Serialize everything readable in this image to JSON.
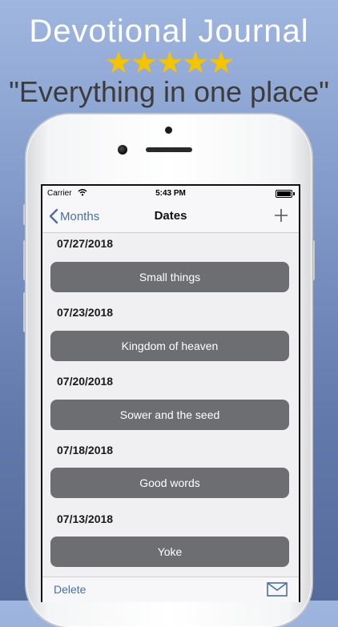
{
  "promo": {
    "title": "Devotional Journal",
    "stars": "★★★★★",
    "tagline": "\"Everything in one place\""
  },
  "status_bar": {
    "carrier": "Carrier",
    "time": "5:43 PM"
  },
  "nav": {
    "back_label": "Months",
    "title": "Dates"
  },
  "entries": [
    {
      "date": "07/27/2018",
      "title": "Small things"
    },
    {
      "date": "07/23/2018",
      "title": "Kingdom of heaven"
    },
    {
      "date": "07/20/2018",
      "title": "Sower and the seed"
    },
    {
      "date": "07/18/2018",
      "title": "Good words"
    },
    {
      "date": "07/13/2018",
      "title": "Yoke"
    }
  ],
  "toolbar": {
    "delete_label": "Delete"
  },
  "colors": {
    "accent": "#4a6fa5",
    "entry_button": "#6d6e72",
    "star": "#f5c400"
  },
  "icons": [
    "wifi-icon",
    "battery-icon",
    "chevron-left-icon",
    "plus-icon",
    "mail-icon"
  ]
}
